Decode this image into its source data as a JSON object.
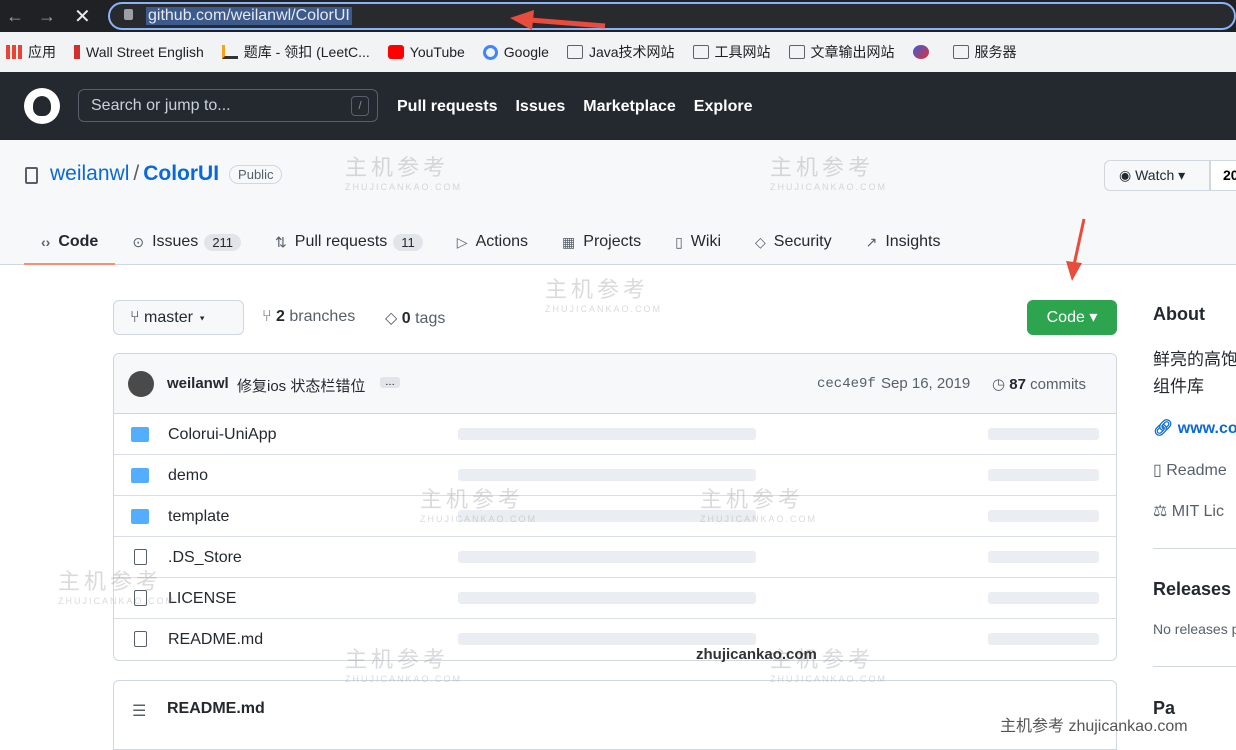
{
  "browser": {
    "url": "github.com/weilanwl/ColorUI",
    "back_icon": "←",
    "forward_icon": "→",
    "stop_icon": "✕"
  },
  "bookmarks": [
    {
      "label": "应用",
      "icon": "apps-icon"
    },
    {
      "label": "Wall Street English",
      "icon": "wse-icon"
    },
    {
      "label": "题库 - 领扣 (LeetC...",
      "icon": "leetcode-icon"
    },
    {
      "label": "YouTube",
      "icon": "youtube-icon"
    },
    {
      "label": "Google",
      "icon": "google-icon"
    },
    {
      "label": "Java技术网站",
      "icon": "folder-icon"
    },
    {
      "label": "工具网站",
      "icon": "folder-icon"
    },
    {
      "label": "文章输出网站",
      "icon": "folder-icon"
    },
    {
      "label": "",
      "icon": "bookmark-logo-icon"
    },
    {
      "label": "服务器",
      "icon": "folder-icon"
    }
  ],
  "gh_header": {
    "search_placeholder": "Search or jump to...",
    "slash": "/",
    "nav": [
      "Pull requests",
      "Issues",
      "Marketplace",
      "Explore"
    ]
  },
  "repo": {
    "owner": "weilanwl",
    "sep": "/",
    "name": "ColorUI",
    "visibility": "Public",
    "watch_label": "Watch",
    "watch_count": "20"
  },
  "tabs": [
    {
      "label": "Code",
      "icon": "‹›",
      "count": ""
    },
    {
      "label": "Issues",
      "icon": "⊙",
      "count": "211"
    },
    {
      "label": "Pull requests",
      "icon": "⇅",
      "count": "11"
    },
    {
      "label": "Actions",
      "icon": "▷",
      "count": ""
    },
    {
      "label": "Projects",
      "icon": "▦",
      "count": ""
    },
    {
      "label": "Wiki",
      "icon": "▯",
      "count": ""
    },
    {
      "label": "Security",
      "icon": "◇",
      "count": ""
    },
    {
      "label": "Insights",
      "icon": "↗",
      "count": ""
    }
  ],
  "branch": {
    "current": "master",
    "branches_count": "2",
    "branches_label": "branches",
    "tags_count": "0",
    "tags_label": "tags",
    "code_button": "Code ▾"
  },
  "commit": {
    "author": "weilanwl",
    "message": "修复ios 状态栏错位",
    "ellipsis": "…",
    "sha": "cec4e9f",
    "date": "Sep 16, 2019",
    "count": "87",
    "count_label": "commits"
  },
  "files": [
    {
      "name": "Colorui-UniApp",
      "type": "folder"
    },
    {
      "name": "demo",
      "type": "folder"
    },
    {
      "name": "template",
      "type": "folder"
    },
    {
      "name": ".DS_Store",
      "type": "file"
    },
    {
      "name": "LICENSE",
      "type": "file"
    },
    {
      "name": "README.md",
      "type": "file"
    }
  ],
  "readme": {
    "title": "README.md"
  },
  "about": {
    "title": "About",
    "desc_line1": "鲜亮的高饱",
    "desc_line2": "组件库",
    "link": "www.co",
    "readme": "Readme",
    "license": "MIT Lic",
    "releases_title": "Releases",
    "no_releases": "No releases p",
    "packages_partial": "Pa"
  },
  "watermarks": {
    "text": "主机参考",
    "sub": "ZHUJICANKAO.COM",
    "footer": "主机参考 zhujicankao.com",
    "center": "zhujicankao.com"
  },
  "colors": {
    "accent": "#0969da",
    "green": "#2da44e",
    "header": "#24292f",
    "arrow": "#e74c3c"
  }
}
